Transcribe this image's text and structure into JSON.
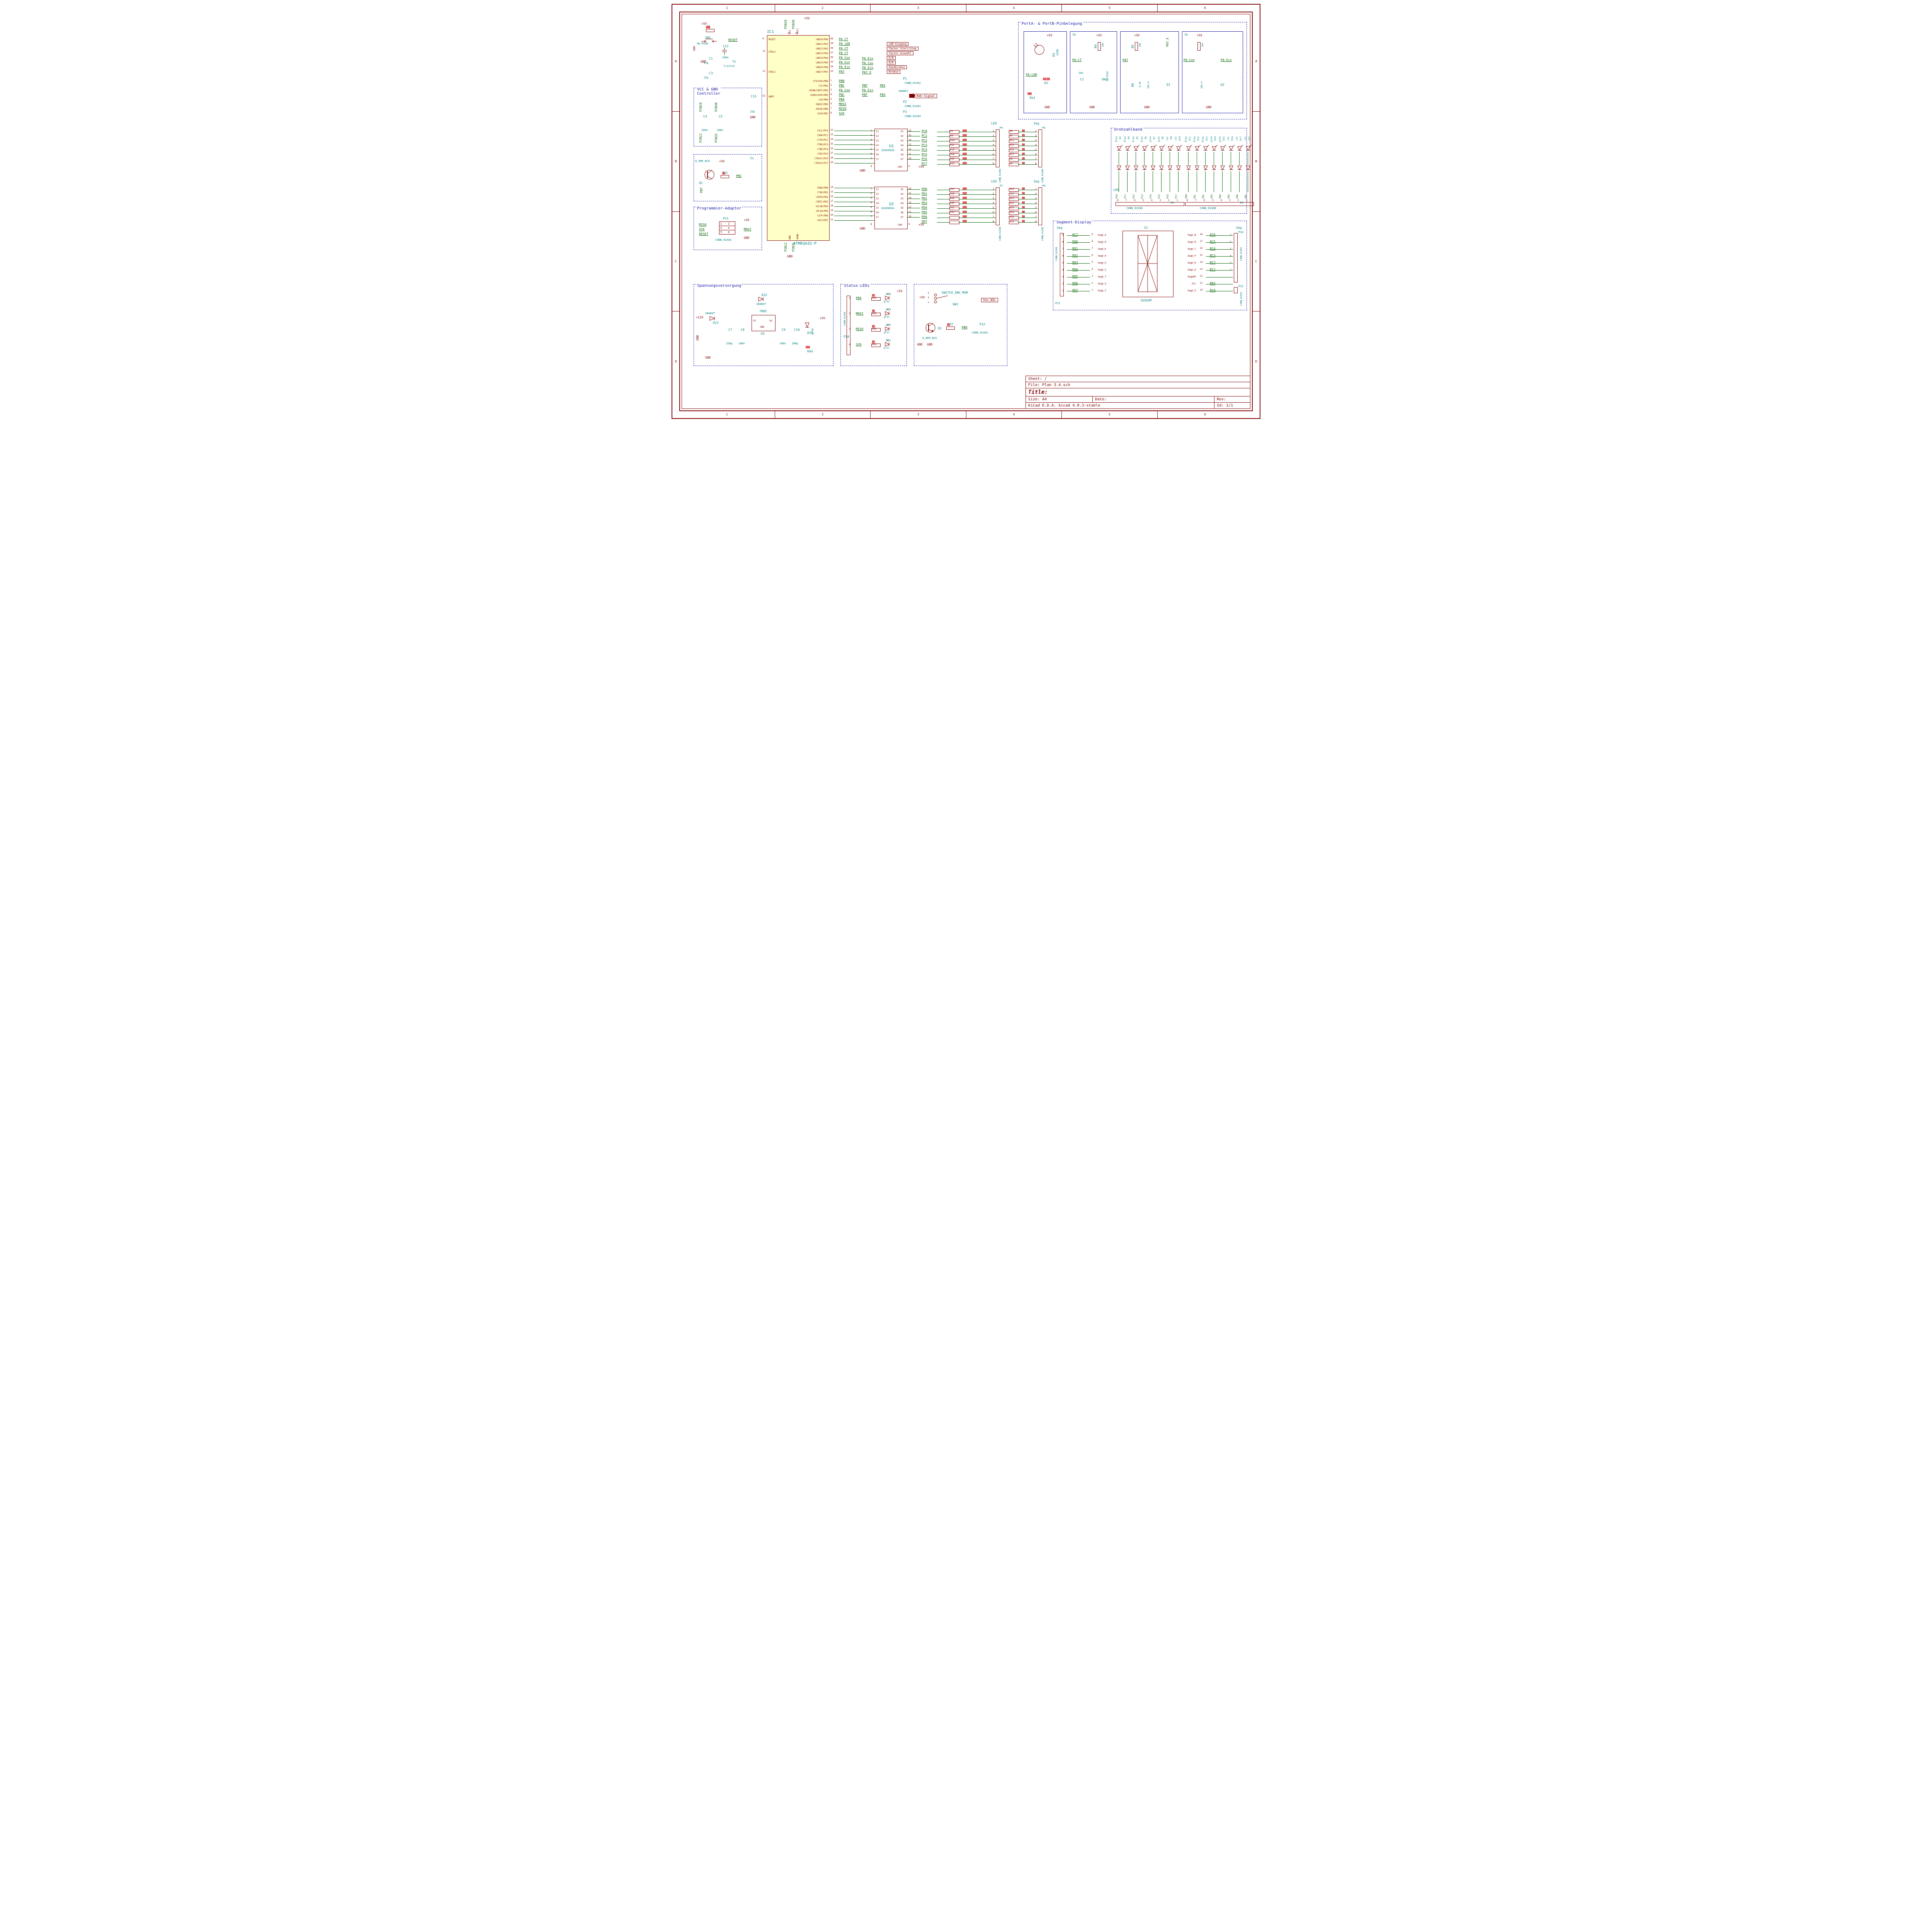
{
  "sheet": {
    "size": "Size: A4",
    "date": "Date:",
    "rev": "Rev:",
    "title": "Title:",
    "file": "File: Plan 3.4.sch",
    "sheet_path": "Sheet: /",
    "kicad": "KiCad E.D.A.  kicad 4.0.3-stable",
    "id": "Id: 1/1"
  },
  "ruler_cols": [
    "1",
    "2",
    "3",
    "4",
    "5",
    "6"
  ],
  "ruler_rows": [
    "A",
    "B",
    "C",
    "D"
  ],
  "boxes": {
    "vcc_gnd": "VCC & GND\nController",
    "prog": "Programmier-Adapter",
    "spannung": "Spannungsversorgung",
    "status": "Status-LEDs",
    "porta": "PortA- & PortB-Pinbelegung",
    "drehzahl": "Drehzahlband",
    "segment": "Segment-Display"
  },
  "mcu": {
    "ref": "IC1",
    "part": "ATMEGA32-P",
    "left_pins": [
      {
        "n": "9",
        "name": "RESET"
      },
      {
        "n": "12",
        "name": "XTAL2"
      },
      {
        "n": "13",
        "name": "XTAL1"
      },
      {
        "n": "32",
        "name": "AREF"
      }
    ],
    "right_pins_pa": [
      {
        "n": "40",
        "name": "(ADC0)PA0",
        "net": "PA_CT"
      },
      {
        "n": "39",
        "name": "(ADC1)PA1",
        "net": "PA_LDR"
      },
      {
        "n": "38",
        "name": "(ADC2)PA2",
        "net": "PA_CT"
      },
      {
        "n": "37",
        "name": "(ADC3)PA3",
        "net": "PA_CT"
      },
      {
        "n": "36",
        "name": "(ADC4)PA4",
        "net": "PA_Con",
        "flag": "LDR-Eingang"
      },
      {
        "n": "35",
        "name": "(ADC5)PA5",
        "net": "PA_Ein",
        "flag": "Taster_Start/Stop"
      },
      {
        "n": "34",
        "name": "(ADC6)PA6",
        "net": "PA_Ein",
        "flag": "Taster_Auswahl"
      },
      {
        "n": "33",
        "name": "(ADC7)PA7",
        "net": "PA7"
      }
    ],
    "pa_flags": [
      "LDR-Eingang",
      "Taster_Start/Stop",
      "Taster_Auswahl",
      "D/N",
      "N/R",
      "Handbremse",
      "Bremse"
    ],
    "pa_extra": [
      "PA_Ein",
      "PA_Con",
      "PA_Ein",
      "PA7_E"
    ],
    "right_pins_pb": [
      {
        "n": "1",
        "name": "(T0/XCK)PB0",
        "net": "PB0"
      },
      {
        "n": "2",
        "name": "(T1)PB1",
        "net": "PBC",
        "net2": "PBT",
        "net3": "PB1"
      },
      {
        "n": "3",
        "name": "(AIN0/INT2)PB2",
        "net": "PA_Con",
        "net2": "PA_Ein"
      },
      {
        "n": "4",
        "name": "(AIN1/OC0)PB3",
        "net": "PBC",
        "net2": "PBT",
        "net3": "PB3"
      },
      {
        "n": "5",
        "name": "(SS)PB4",
        "net": "PB4"
      },
      {
        "n": "6",
        "name": "(MOSI)PB5",
        "net": "MOSI"
      },
      {
        "n": "7",
        "name": "(MISO)PB6",
        "net": "MISO"
      },
      {
        "n": "8",
        "name": "(SCK)PB7",
        "net": "SCK"
      }
    ],
    "right_pins_pc": [
      {
        "n": "22",
        "name": "(SCL)PC0"
      },
      {
        "n": "23",
        "name": "(SDA)PC1"
      },
      {
        "n": "24",
        "name": "(TCK)PC2"
      },
      {
        "n": "25",
        "name": "(TMS)PC3"
      },
      {
        "n": "26",
        "name": "(TDO)PC4"
      },
      {
        "n": "27",
        "name": "(TDI)PC5"
      },
      {
        "n": "28",
        "name": "(TOSC1)PC6"
      },
      {
        "n": "29",
        "name": "(TOSC2)PC7"
      }
    ],
    "right_pins_pd": [
      {
        "n": "14",
        "name": "(RXD)PD0"
      },
      {
        "n": "15",
        "name": "(TXD)PD1"
      },
      {
        "n": "16",
        "name": "(INT0)PD2"
      },
      {
        "n": "17",
        "name": "(INT1)PD3"
      },
      {
        "n": "18",
        "name": "(OC1B)PD4"
      },
      {
        "n": "19",
        "name": "(OC1A)PD5"
      },
      {
        "n": "20",
        "name": "(ICP)PD6"
      },
      {
        "n": "21",
        "name": "(OC2)PD7"
      }
    ],
    "pwr": [
      {
        "n": "10",
        "name": "VCC",
        "net": "PIN10"
      },
      {
        "n": "30",
        "name": "AVCC",
        "net": "PIN30"
      },
      {
        "n": "11",
        "name": "GND",
        "net": "PIN11"
      },
      {
        "n": "31",
        "name": "AGND",
        "net": "PIN31"
      }
    ]
  },
  "uln": [
    {
      "ref": "U1",
      "part": "ULN2003A",
      "out_nets": [
        "PC0",
        "PC1",
        "PC2",
        "PC3",
        "PC4",
        "PC5",
        "PC6",
        "PC7"
      ],
      "out_pins": [
        "16",
        "15",
        "14",
        "13",
        "12",
        "11",
        "10"
      ],
      "in_pins": [
        "1",
        "2",
        "3",
        "4",
        "5",
        "6",
        "7"
      ],
      "com": "9",
      "gnd": "8",
      "res_led": [
        "R2",
        "R6",
        "R10",
        "R12",
        "R14",
        "R16",
        "R20",
        "R22"
      ],
      "res_seg": [
        "R8",
        "R9",
        "R11",
        "R13",
        "R15",
        "R17"
      ],
      "val_led": "150",
      "val_seg": "68"
    },
    {
      "ref": "U2",
      "part": "ULN2003A",
      "out_nets": [
        "PD0",
        "PD1",
        "PD2",
        "PD3",
        "PD4",
        "PD5",
        "PD6",
        "PD7"
      ],
      "out_pins": [
        "16",
        "15",
        "14",
        "13",
        "12",
        "11",
        "10"
      ],
      "in_pins": [
        "1",
        "2",
        "3",
        "4",
        "5",
        "6",
        "7"
      ],
      "com": "9",
      "gnd": "8",
      "res_led": [
        "R24",
        "R26",
        "R28",
        "R30",
        "R32",
        "R33"
      ],
      "res_seg": [
        "R18",
        "R19",
        "R21",
        "R23",
        "R25",
        "R34"
      ],
      "res_led_val": "150",
      "res_seg_val": "68",
      "extra": [
        "R27",
        "R29",
        "R31"
      ],
      "extra_val": "150"
    }
  ],
  "conn_labels": {
    "P1": "CONN_01X02",
    "P2": "CONN_01X01",
    "P3": "CONN_01X04",
    "P4": "CONN_01X08",
    "P5": "CONN_01X08",
    "P6": "CONN_01X08",
    "P7": "CONN_01X08",
    "P8": "CONN_01X08",
    "P9": "CONN_01X08",
    "P10": "CONN_01X07",
    "P11": "CONN_02X03",
    "P12": "CONN_01X01",
    "P13": "CONN_01X09",
    "P14": "CONN_01X04",
    "P15": "CONN_01X01"
  },
  "flags": {
    "kmh": "Kmh-Signal",
    "diode": "1N4007",
    "von_nsl": "Von_NSL"
  },
  "reset_block": {
    "r": "R1",
    "r_val": "10k",
    "sw": "SW1",
    "sw_type": "SW_PUSH",
    "c12": "C12",
    "c12_val": "100n",
    "c1": "C1",
    "c1_val": "22p",
    "c3": "C3",
    "c3_val": "22p",
    "y1": "Y1",
    "y1_val": "Crystal",
    "net": "RESET",
    "pwr": "+5V",
    "gnd": "GND",
    "c13": "C13",
    "c13_val": "22p"
  },
  "vcc_gnd_block": {
    "c4": "C4",
    "c5": "C5",
    "val": "100n",
    "pins": [
      "PIN10",
      "PIN30",
      "PIN11",
      "PIN31"
    ]
  },
  "pbc_block": {
    "q": "Q1",
    "q_type": "Q_PNP_BCE",
    "r": "R31",
    "r_val": "1k",
    "nets": [
      "PBC",
      "PBT"
    ],
    "mult": "2x",
    "pwr": "+5V"
  },
  "prog_block": {
    "nets": [
      "MISO",
      "SCK",
      "RESET",
      "MOSI"
    ],
    "ref": "P11",
    "type": "CONN_02X03",
    "pwr": "+5V",
    "gnd": "GND",
    "pins": [
      "1",
      "3",
      "5",
      "2",
      "4",
      "6"
    ]
  },
  "psu": {
    "d22": "D22",
    "d23": "D23",
    "d_val": "1N4007",
    "u3": "U3",
    "u3_val": "7805",
    "c7": "C7",
    "c7_val": "220µ",
    "c8": "C8",
    "c8_val": "100n",
    "c9": "C9",
    "c9_val": "100n",
    "c10": "C10",
    "c10_val": "100µ",
    "d25": "D25",
    "d25_col": "grün",
    "r44": "R44",
    "r44_val": "150",
    "vin": "+12V",
    "vout": "+5V",
    "gnd": "GND"
  },
  "status_leds": {
    "ref": "P14",
    "nets": [
      "PB4",
      "MOSI",
      "MISO",
      "SCK"
    ],
    "res": [
      "R35",
      "R36",
      "R38",
      "R39"
    ],
    "r_val": "82",
    "leds": [
      "D18",
      "D19",
      "D20",
      "D21"
    ],
    "col": "grün",
    "pwr": "+5V"
  },
  "switch_block": {
    "sw": "SW3",
    "sw_type": "SWITCH_INV_MSM",
    "q": "Q2",
    "q_type": "Q_NPN_BCE",
    "r": "R37",
    "r_val": "1k",
    "net": "PB0",
    "conn": "P12",
    "flag": "Von_NSL",
    "pwr": "+5V",
    "gnd": "GND",
    "pins": [
      "1",
      "2",
      "3"
    ]
  },
  "porta_block": {
    "ldr": {
      "net": "PA-LDR",
      "r3": "R3",
      "r3_val": "220k",
      "r7": "R7",
      "r7_val": "33.3k",
      "rv1": "RV1",
      "rv1_val": "10k",
      "pwr": "+5V",
      "gnd": "GND"
    },
    "ct": {
      "mult": "3x",
      "net": "PA-CT",
      "r4": "R4",
      "r4_val": "10k",
      "c2": "C2",
      "c2_val": "20n",
      "sw2": "SW2",
      "sw2_type": "SW_PUSH",
      "pwr": "+5V",
      "gnd": "GND"
    },
    "pa7": {
      "net": "PA7",
      "net2": "PA7_E",
      "r5": "R5",
      "r5_val": "10k",
      "r6": "R6",
      "r6_val": "6.8k",
      "z": "Z05.6",
      "d": "D1",
      "pwr": "+5V",
      "gnd": "GND"
    },
    "con": {
      "mult": "3x",
      "net1": "PA-Con",
      "net2": "PA-Ein",
      "r": "10k",
      "z": "Z05.6",
      "d": "D2",
      "pwr": "+5V",
      "gnd": "GND"
    }
  },
  "drehzahl": {
    "led_nets": [
      "PC0",
      "PC1",
      "PC2",
      "PC3",
      "PC4",
      "PC5",
      "PC6",
      "PC7"
    ],
    "led_refs": [
      "D3",
      "D4",
      "D5",
      "D6",
      "D7",
      "D8",
      "D9",
      "D10"
    ],
    "led_cols": [
      "blau",
      "blau",
      "blau",
      "blau",
      "grün",
      "grün",
      "rot",
      "rot"
    ],
    "led2_nets": [
      "PD0",
      "PD1",
      "PD2",
      "PD3",
      "PD4",
      "PD5",
      "PD6",
      "PB1"
    ],
    "led2_refs": [
      "D11",
      "D12",
      "D13",
      "D14",
      "D15",
      "D16",
      "D17",
      "rot"
    ],
    "led2_cols": [
      "blau",
      "blau",
      "blau",
      "grün",
      "grün",
      "rot",
      "rot",
      "rot"
    ],
    "conn": "CONN_01X08",
    "p8": "P8",
    "p9": "P9",
    "label": "LED",
    "pins_l": [
      "8",
      "7",
      "6",
      "5",
      "4",
      "3",
      "2",
      "1"
    ],
    "pins_r": [
      "8",
      "7",
      "6",
      "5",
      "4",
      "3",
      "2",
      "1"
    ]
  },
  "segment": {
    "ref": "S1",
    "part": "16SEGM",
    "left_pins": [
      {
        "p": "9",
        "net": "PC7",
        "seg": "Segm_A"
      },
      {
        "p": "8",
        "net": "PD0",
        "seg": "Segm_M"
      },
      {
        "p": "7",
        "net": "PD1",
        "seg": "Segm_K"
      },
      {
        "p": "6",
        "net": "PD2",
        "seg": "Segm_H"
      },
      {
        "p": "5",
        "net": "PD3",
        "seg": "Segm_U"
      },
      {
        "p": "4",
        "net": "PD4",
        "seg": "Segm_S"
      },
      {
        "p": "3",
        "net": "PD5",
        "seg": "Segm_T"
      },
      {
        "p": "2",
        "net": "PD6",
        "seg": "Segm_G"
      },
      {
        "p": "1",
        "net": "PD7",
        "seg": "Segm_F"
      }
    ],
    "right_pins": [
      {
        "p": "18",
        "net": "PC6",
        "seg": "Segm_B"
      },
      {
        "p": "17",
        "net": "PC5",
        "seg": "Segm_N"
      },
      {
        "p": "16",
        "net": "PC4",
        "seg": "Segm_C"
      },
      {
        "p": "15",
        "net": "PC3",
        "seg": "Segm_P"
      },
      {
        "p": "14",
        "net": "PC2",
        "seg": "Segm_R"
      },
      {
        "p": "13",
        "net": "PC1",
        "seg": "Segm_D"
      },
      {
        "p": "12",
        "net": "",
        "seg": "SegmDP"
      },
      {
        "p": "11",
        "net": "PB3",
        "seg": "VCC"
      },
      {
        "p": "10",
        "net": "PC0",
        "seg": "Segm_E"
      }
    ],
    "conn_l": "P13",
    "conn_l_type": "CONN_01X09",
    "conn_r": "P10",
    "conn_r_type": "CONN_01X07",
    "conn_r2": "P15",
    "conn_r2_type": "CONN_01X01",
    "seg_label": "Seg"
  },
  "conn_headers": {
    "LED": "LED",
    "Seg": "Seg"
  }
}
